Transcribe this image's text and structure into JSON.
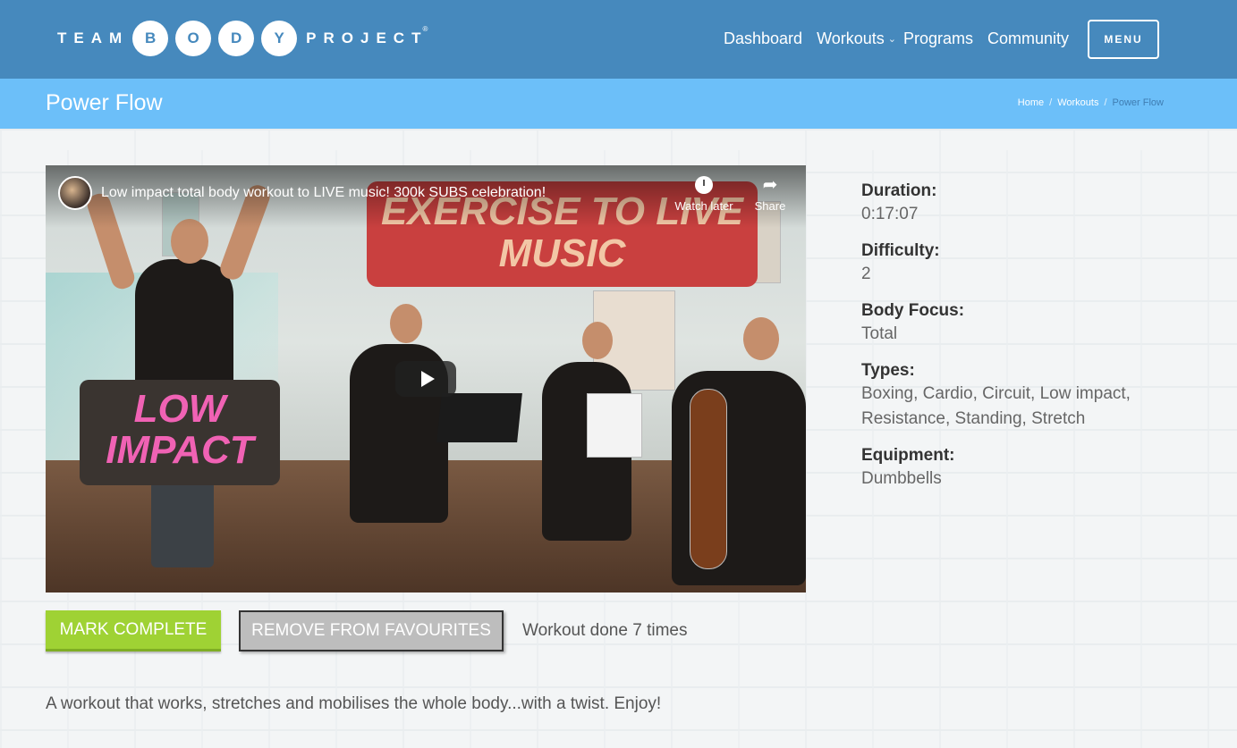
{
  "header": {
    "logo": {
      "word_left": "TEAM",
      "letters": [
        "B",
        "O",
        "D",
        "Y"
      ],
      "word_right": "PROJECT",
      "registered": "®"
    },
    "nav": [
      "Dashboard",
      "Workouts",
      "Programs",
      "Community"
    ],
    "nav_caret": "⌄",
    "menu_label": "MENU",
    "colors": {
      "header_bg": "#4689bd",
      "titlebar_bg": "#6cbff9"
    }
  },
  "page": {
    "title": "Power Flow",
    "breadcrumb": [
      "Home",
      "Workouts",
      "Power Flow"
    ],
    "breadcrumb_sep": "/"
  },
  "video": {
    "title": "Low impact total body workout to LIVE music! 300k SUBS celebration!",
    "watch_later_label": "Watch later",
    "share_label": "Share",
    "banner_top": "EXERCISE TO LIVE MUSIC",
    "banner_left": "LOW IMPACT"
  },
  "actions": {
    "mark_complete": "MARK COMPLETE",
    "remove_favourites": "REMOVE FROM FAVOURITES",
    "done_text": "Workout done 7 times",
    "colors": {
      "complete_bg": "#9fd234",
      "remove_bg": "#bdbdbd"
    }
  },
  "description": "A workout that works, stretches and mobilises the whole body...with a twist. Enjoy!",
  "details": [
    {
      "label": "Duration:",
      "value": "0:17:07"
    },
    {
      "label": "Difficulty:",
      "value": "2"
    },
    {
      "label": "Body Focus:",
      "value": "Total"
    },
    {
      "label": "Types:",
      "value": "Boxing, Cardio, Circuit, Low impact, Resistance, Standing, Stretch"
    },
    {
      "label": "Equipment:",
      "value": "Dumbbells"
    }
  ]
}
